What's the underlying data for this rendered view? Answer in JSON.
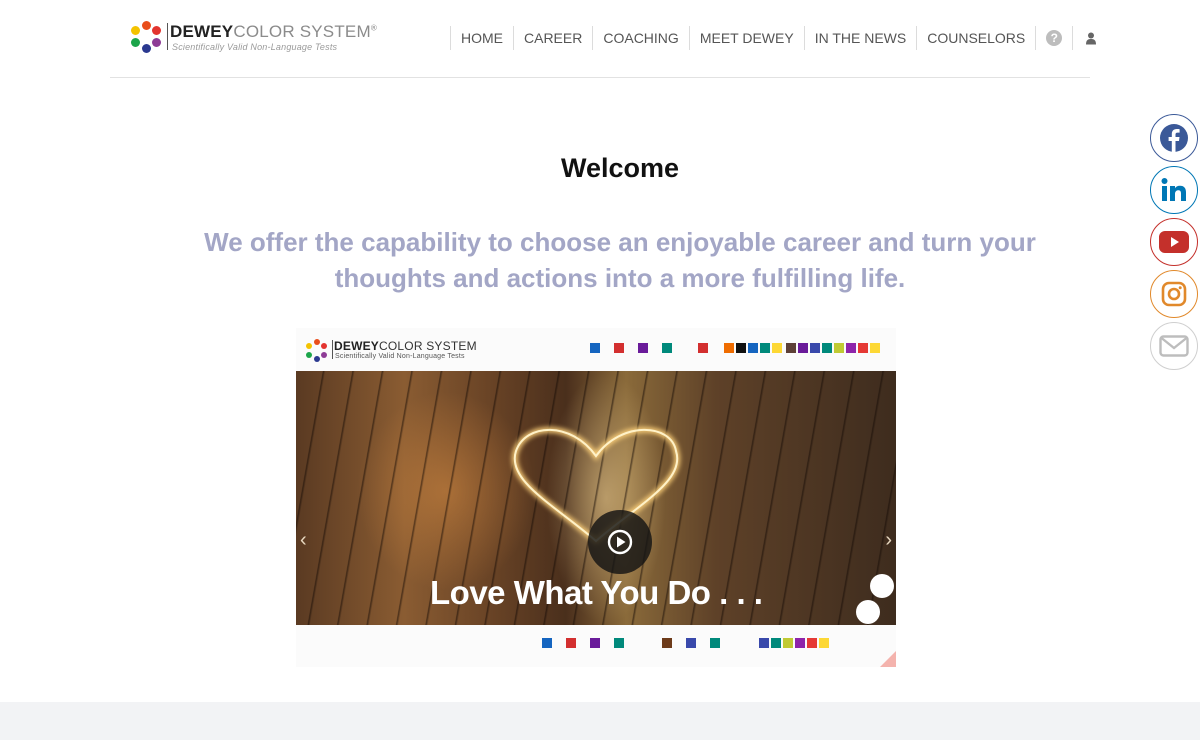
{
  "brand": {
    "name_bold": "DEWEY",
    "name_light": "COLOR SYSTEM",
    "tagline": "Scientifically Valid Non-Language Tests",
    "trademark": "®",
    "dot_colors": [
      "#f4c300",
      "#e94e1b",
      "#e3342f",
      "#1ca54a",
      "#0066b3",
      "#8e3c96",
      "#2b3990"
    ]
  },
  "nav": {
    "items": [
      {
        "label": "HOME"
      },
      {
        "label": "CAREER"
      },
      {
        "label": "COACHING"
      },
      {
        "label": "MEET DEWEY"
      },
      {
        "label": "IN THE NEWS"
      },
      {
        "label": "COUNSELORS"
      }
    ],
    "help_icon": "question-circle-icon",
    "help_glyph": "?",
    "account_icon": "user-icon"
  },
  "main": {
    "heading": "Welcome",
    "tagline": "We offer the capability to choose an enjoyable career and turn your thoughts and actions into a more fulfilling life."
  },
  "video": {
    "caption": "Love What You Do . . .",
    "prev_icon": "chevron-left-icon",
    "next_icon": "chevron-right-icon",
    "play_icon": "play-icon",
    "prev_glyph": "‹",
    "next_glyph": "›",
    "top_swatch_colors": [
      "#1565c0",
      "#d32f2f",
      "#6a1b9a",
      "#00897b",
      "#d32f2f",
      "#ef6c00",
      "#111111",
      "#1565c0",
      "#00897b",
      "#fdd835",
      "#5d4037",
      "#6a1b9a",
      "#3949ab",
      "#00897b",
      "#c0ca33",
      "#8e24aa",
      "#e53935",
      "#fdd835"
    ],
    "bottom_swatch_colors": [
      "#1565c0",
      "#d32f2f",
      "#6a1b9a",
      "#00897b",
      "#6d3b1a",
      "#3949ab",
      "#00897b",
      "#3949ab",
      "#00897b",
      "#c0ca33",
      "#8e24aa",
      "#e53935",
      "#fdd835"
    ]
  },
  "social": [
    {
      "name": "facebook-icon",
      "color": "#3b5998"
    },
    {
      "name": "linkedin-icon",
      "color": "#0077b5"
    },
    {
      "name": "youtube-icon",
      "color": "#c4302b"
    },
    {
      "name": "instagram-icon",
      "color": "#e1892b"
    },
    {
      "name": "email-icon",
      "color": "#bdbdbd"
    }
  ],
  "colors": {
    "tagline": "#a3a6c6",
    "nav_text": "#555555",
    "footer_band": "#f2f3f5"
  }
}
